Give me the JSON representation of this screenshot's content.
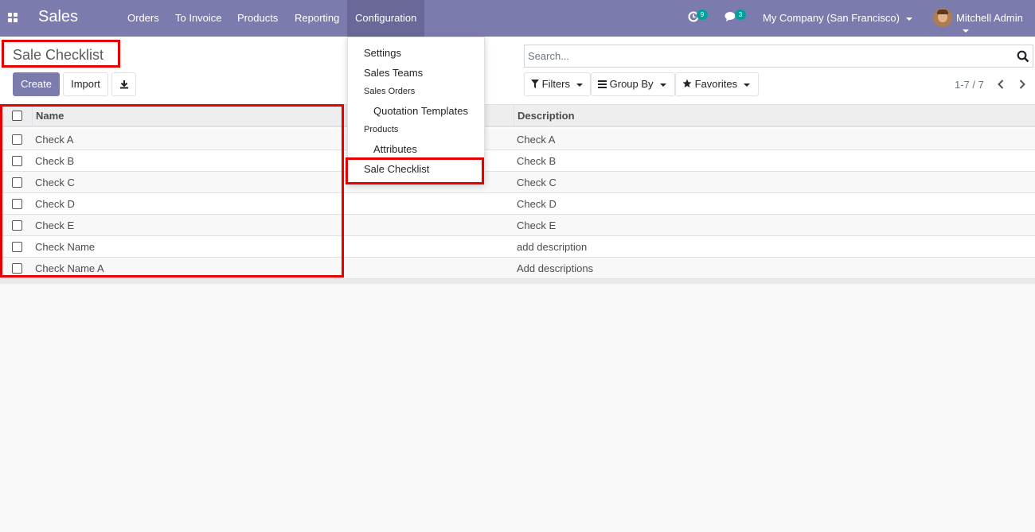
{
  "navbar": {
    "app_name": "Sales",
    "menu": [
      "Orders",
      "To Invoice",
      "Products",
      "Reporting",
      "Configuration"
    ],
    "activity_count": "9",
    "messages_count": "3",
    "company": "My Company (San Francisco)",
    "user": "Mitchell Admin"
  },
  "control_panel": {
    "title": "Sale Checklist",
    "create_label": "Create",
    "import_label": "Import",
    "search_placeholder": "Search...",
    "filters_label": "Filters",
    "group_by_label": "Group By",
    "favorites_label": "Favorites",
    "pager": "1-7 / 7"
  },
  "configuration_menu": {
    "settings": "Settings",
    "sales_teams": "Sales Teams",
    "sales_orders_header": "Sales Orders",
    "quotation_templates": "Quotation Templates",
    "products_header": "Products",
    "attributes": "Attributes",
    "sale_checklist": "Sale Checklist"
  },
  "table": {
    "columns": [
      "Name",
      "Description"
    ],
    "rows": [
      {
        "name": "Check A",
        "description": "Check A"
      },
      {
        "name": "Check B",
        "description": "Check B"
      },
      {
        "name": "Check C",
        "description": "Check C"
      },
      {
        "name": "Check D",
        "description": "Check D"
      },
      {
        "name": "Check E",
        "description": "Check E"
      },
      {
        "name": "Check Name",
        "description": "add description"
      },
      {
        "name": "Check Name A",
        "description": "Add descriptions"
      }
    ]
  },
  "colors": {
    "brand": "#7c7bad",
    "brand_dark": "#696898",
    "badge": "#00a09d",
    "highlight": "#e60000"
  },
  "icons": {
    "apps": "apps-grid-icon",
    "activity": "clock-icon",
    "messages": "chat-icon",
    "search": "search-icon",
    "download": "download-icon",
    "filter": "filter-icon",
    "group_by": "list-icon",
    "favorites": "star-icon",
    "pager_prev": "chevron-left-icon",
    "pager_next": "chevron-right-icon"
  }
}
